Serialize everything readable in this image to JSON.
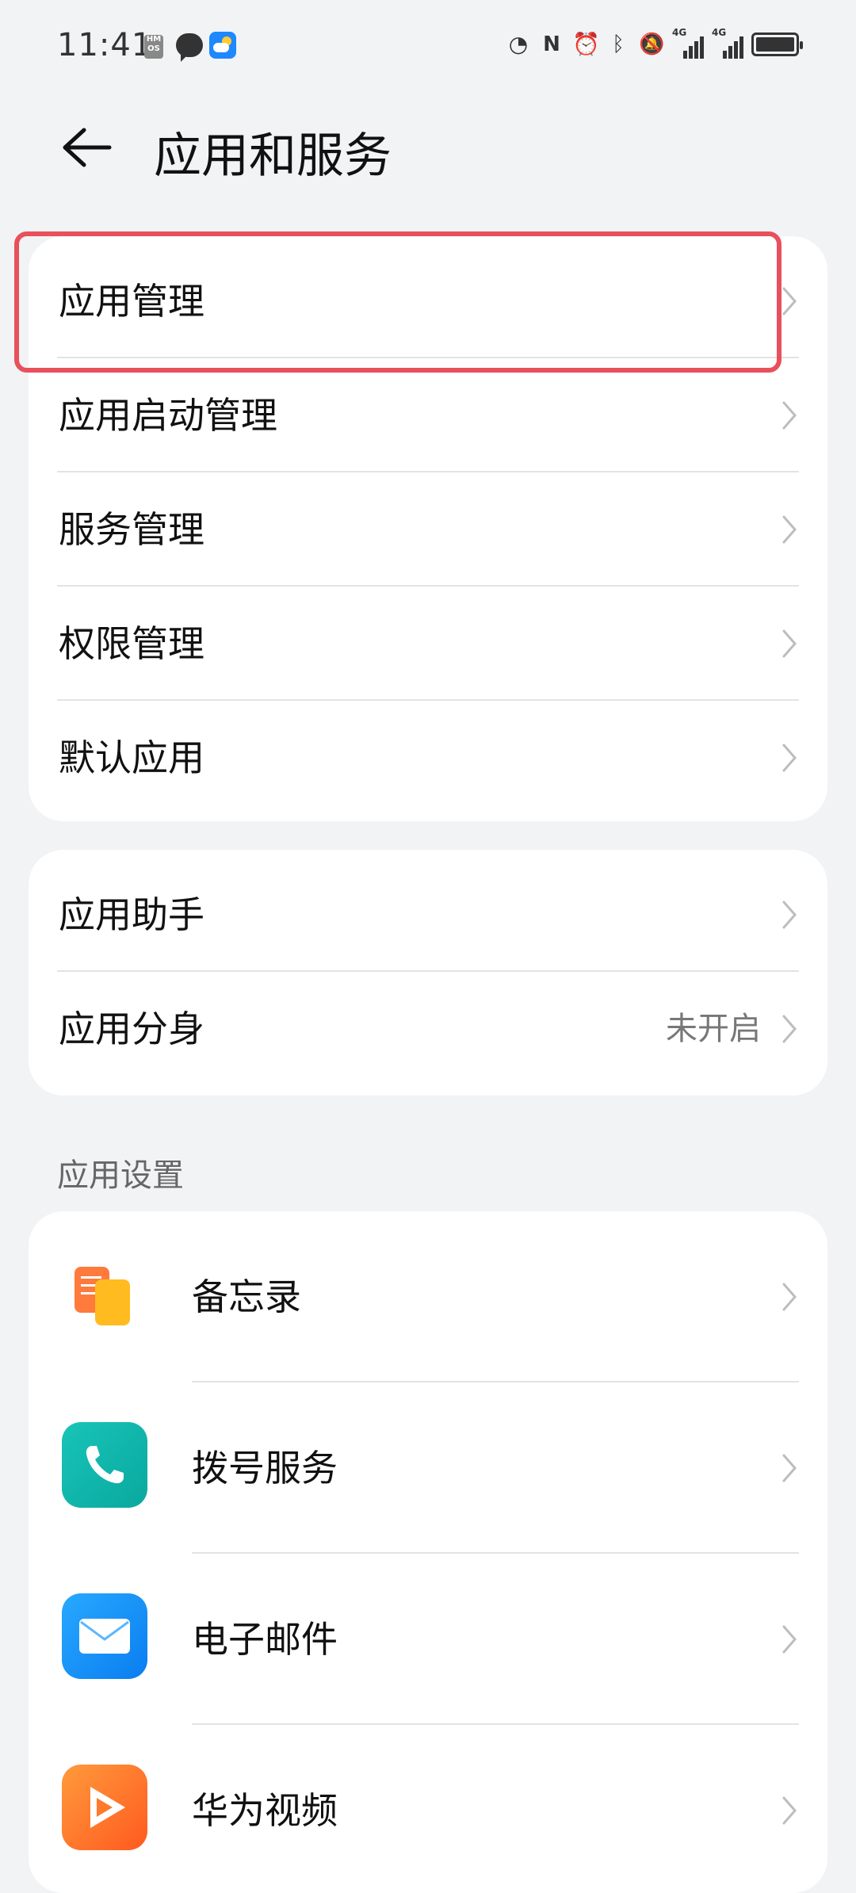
{
  "status_bar": {
    "time": "11:41",
    "hmos_badge": "HM OS",
    "signal1_label": "4G",
    "signal2_label": "4G"
  },
  "header": {
    "title": "应用和服务",
    "back_icon": "back-arrow-icon"
  },
  "group1": {
    "items": [
      {
        "label": "应用管理"
      },
      {
        "label": "应用启动管理"
      },
      {
        "label": "服务管理"
      },
      {
        "label": "权限管理"
      },
      {
        "label": "默认应用"
      }
    ]
  },
  "group2": {
    "items": [
      {
        "label": "应用助手",
        "value": ""
      },
      {
        "label": "应用分身",
        "value": "未开启"
      }
    ]
  },
  "app_settings": {
    "section_title": "应用设置",
    "apps": [
      {
        "label": "备忘录",
        "icon": "memo-icon"
      },
      {
        "label": "拨号服务",
        "icon": "phone-icon"
      },
      {
        "label": "电子邮件",
        "icon": "mail-icon"
      },
      {
        "label": "华为视频",
        "icon": "video-icon"
      }
    ]
  },
  "colors": {
    "highlight": "#e8505b",
    "background": "#f1f3f5",
    "card": "#ffffff"
  }
}
